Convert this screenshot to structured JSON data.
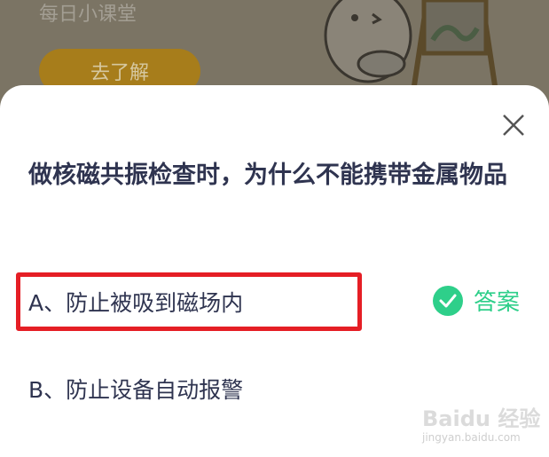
{
  "banner": {
    "title": "每日小课堂",
    "button_label": "去了解"
  },
  "quiz": {
    "question": "做核磁共振检查时，为什么不能携带金属物品",
    "options": [
      {
        "label": "A、防止被吸到磁场内",
        "is_answer": true
      },
      {
        "label": "B、防止设备自动报警",
        "is_answer": false
      }
    ],
    "answer_label": "答案",
    "answer_color": "#2ecf8a",
    "highlight_color": "#e51e25"
  },
  "watermark": {
    "logo_text": "Baidu 经验",
    "url": "jingyan.baidu.com"
  }
}
